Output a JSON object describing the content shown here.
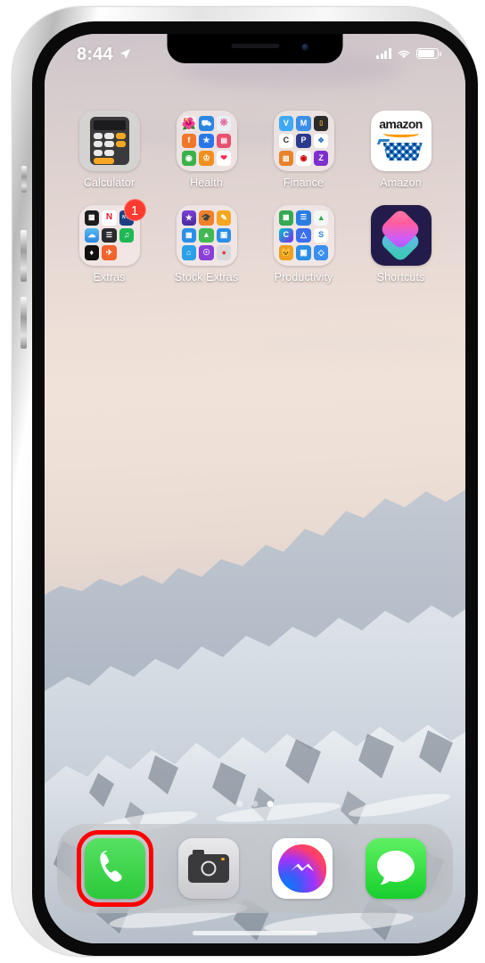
{
  "device": {
    "type": "iphone-x-frame"
  },
  "status_bar": {
    "time": "8:44",
    "location_icon": "location-arrow-icon",
    "cellular_icon": "cellular-bars-icon",
    "wifi_icon": "wifi-icon",
    "battery_icon": "battery-icon",
    "battery_level_percent": 88
  },
  "home_screen": {
    "apps": [
      {
        "label": "Calculator",
        "kind": "app",
        "icon": "calculator-icon",
        "badge": null
      },
      {
        "label": "Health",
        "kind": "folder",
        "icon": "health-folder",
        "mini_icons": [
          "#f04e8c",
          "#2b86e0",
          "#e8eef5",
          "#f0772a",
          "#2a77e8",
          "#e8506f",
          "#3ab24a",
          "#f09020",
          "#ffffff"
        ]
      },
      {
        "label": "Finance",
        "kind": "folder",
        "icon": "finance-folder",
        "mini_icons": [
          "#3fa9f5",
          "#3b8fe8",
          "#2b2b2b",
          "#ffffff",
          "#2c3a8c",
          "#ffffff",
          "#e8832a",
          "#cc0000",
          "#7e2fcc"
        ]
      },
      {
        "label": "Amazon",
        "kind": "app",
        "icon": "amazon-icon",
        "badge": null
      },
      {
        "label": "Extras",
        "kind": "folder",
        "icon": "extras-folder",
        "badge": "1",
        "mini_icons": [
          "#1c1c1e",
          "#ffffff",
          "#1c3f84",
          "#56b9f0",
          "#2a2a2c",
          "#1db954",
          "#111111",
          "#f4622e",
          "#ffffff"
        ]
      },
      {
        "label": "Stock Extras",
        "kind": "folder",
        "icon": "stock-extras-folder",
        "mini_icons": [
          "#5b2fb0",
          "#f0802a",
          "#f5a623",
          "#2b8fe8",
          "#3fba52",
          "#2b8fe8",
          "#2b9fe8",
          "#8a3fd6",
          "#d8d8da"
        ]
      },
      {
        "label": "Productivity",
        "kind": "folder",
        "icon": "productivity-folder",
        "mini_icons": [
          "#34a853",
          "#2b7de0",
          "#f5f5f5",
          "#8a3fd6",
          "#3b6ff0",
          "#ffffff",
          "#f0a020",
          "#2b8fe8",
          "#3b8ff0"
        ]
      },
      {
        "label": "Shortcuts",
        "kind": "app",
        "icon": "shortcuts-icon",
        "badge": null
      }
    ],
    "page_dots": {
      "count": 3,
      "active_index": 2
    },
    "dock": [
      {
        "label": "Phone",
        "icon": "phone-icon",
        "highlighted": true
      },
      {
        "label": "Camera",
        "icon": "camera-icon",
        "highlighted": false
      },
      {
        "label": "Messenger",
        "icon": "messenger-icon",
        "highlighted": false
      },
      {
        "label": "Messages",
        "icon": "messages-icon",
        "highlighted": false
      }
    ]
  },
  "annotation": {
    "highlight_color": "#ff0000",
    "target": "Phone"
  },
  "colors": {
    "badge_red": "#ff3b30",
    "phone_green": "#2bc93a",
    "messages_green": "#17cf2c",
    "wallpaper_sky": "#ecdfd7"
  }
}
